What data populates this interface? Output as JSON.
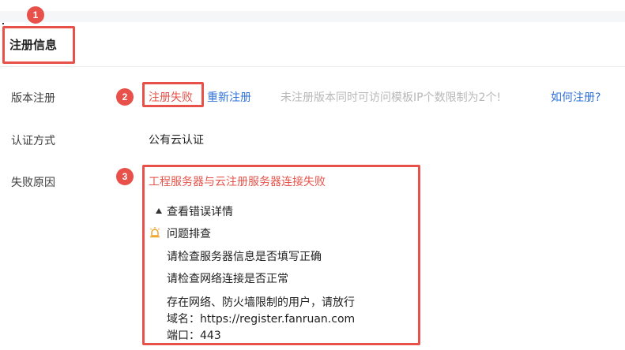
{
  "section": {
    "title": "注册信息"
  },
  "version_row": {
    "label": "版本注册",
    "status": "注册失败",
    "re_register": "重新注册",
    "hint": "未注册版本同时可访问模板IP个数限制为2个!",
    "how_link": "如何注册?"
  },
  "auth_row": {
    "label": "认证方式",
    "value": "公有云认证"
  },
  "fail_row": {
    "label": "失败原因",
    "reason": "工程服务器与云注册服务器连接失败",
    "toggle": "查看错误详情",
    "troubleshoot_title": "问题排查",
    "tips": [
      "请检查服务器信息是否填写正确",
      "请检查网络连接是否正常",
      "存在网络、防火墙限制的用户，请放行",
      "域名：https://register.fanruan.com",
      "端口：443"
    ]
  },
  "annotations": [
    "1",
    "2",
    "3"
  ],
  "colors": {
    "error": "#e5544b",
    "link": "#2f72d8",
    "hint": "#b8b8b8",
    "annotation": "#e8514a"
  },
  "icons": {
    "troubleshoot": "alarm-bell-icon",
    "toggle": "triangle-up-icon"
  }
}
